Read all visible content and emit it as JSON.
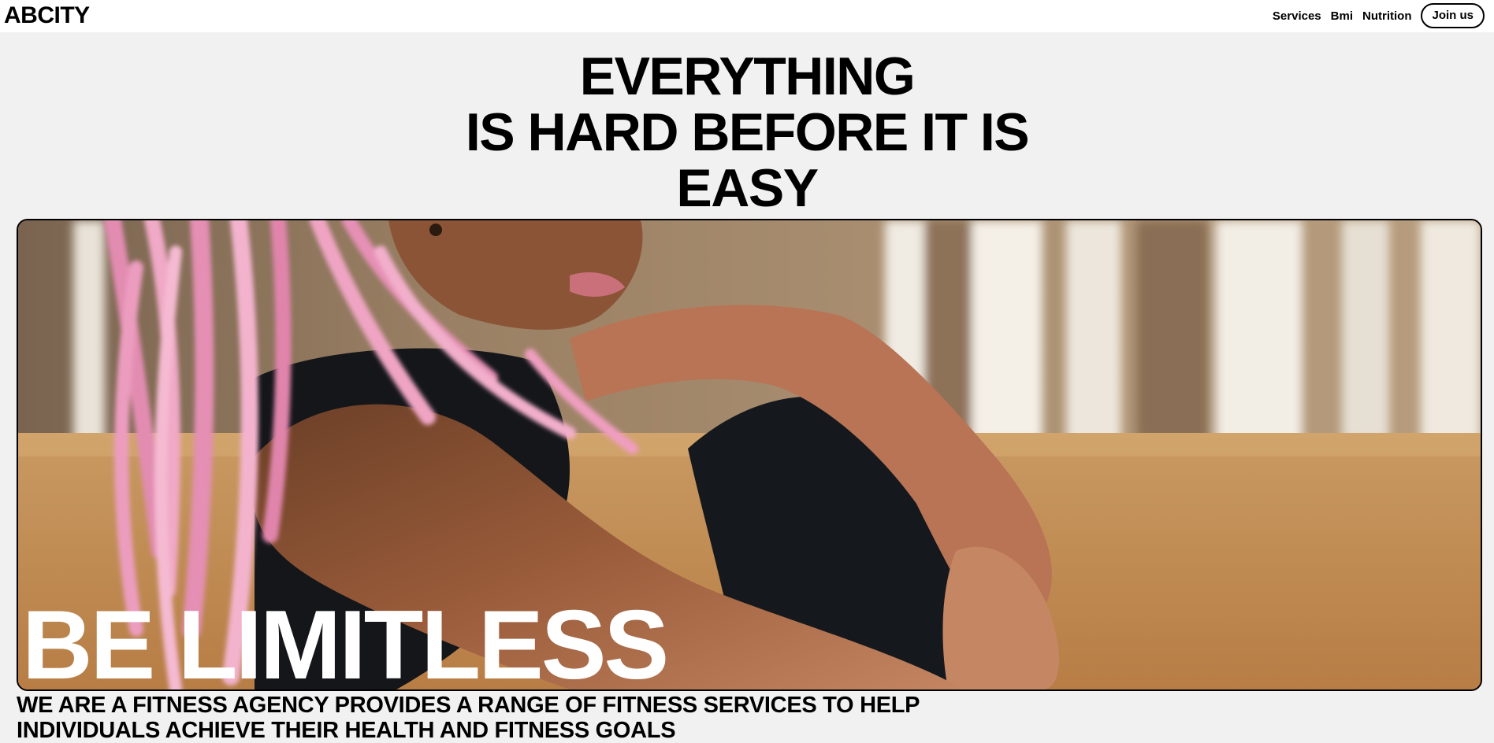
{
  "header": {
    "logo": "ABCITY",
    "nav": [
      "Services",
      "Bmi",
      "Nutrition"
    ],
    "cta_label": "Join us"
  },
  "hero": {
    "headline_lines": [
      "EVERYTHING",
      "IS HARD BEFORE IT IS",
      "EASY"
    ],
    "image_overlay_text": "BE LIMITLESS",
    "image_subject": "woman-with-pink-braids-resting"
  },
  "about": {
    "text": "WE ARE A FITNESS AGENCY PROVIDES A RANGE OF FITNESS SERVICES TO HELP INDIVIDUALS ACHIEVE THEIR HEALTH AND FITNESS GOALS"
  },
  "colors": {
    "page_bg": "#f1f1f1",
    "header_bg": "#ffffff",
    "text": "#000000",
    "accent_hair": "#e58fb0",
    "floor": "#c99858"
  }
}
